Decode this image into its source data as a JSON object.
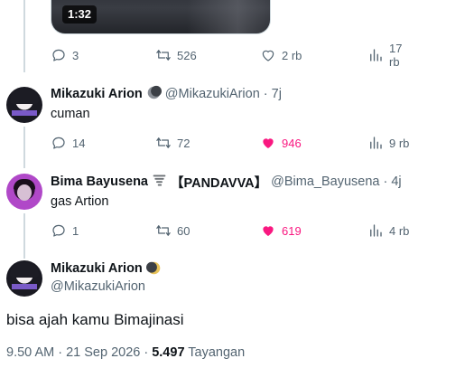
{
  "top_tweet": {
    "video_duration": "1:32",
    "actions": {
      "replies": "3",
      "retweets": "526",
      "likes": "2 rb",
      "views": "17 rb"
    }
  },
  "replies": [
    {
      "name": "Mikazuki Arion",
      "badge_icon": "moon-icon",
      "handle": "@MikazukiArion",
      "time": "· 7j",
      "text": "cuman",
      "actions": {
        "replies": "14",
        "retweets": "72",
        "likes": "946",
        "views": "9 rb",
        "liked": true
      }
    },
    {
      "name": "Bima Bayusena",
      "badge_icon": "tornado-icon",
      "name_suffix": "【PANDAVVA】",
      "handle": "@Bima_Bayusena",
      "time": "· 4j",
      "text": "gas Artion",
      "actions": {
        "replies": "1",
        "retweets": "60",
        "likes": "619",
        "views": "4 rb",
        "liked": true
      }
    }
  ],
  "main_tweet": {
    "name": "Mikazuki Arion",
    "badge_icon": "moon-icon",
    "handle": "@MikazukiArion",
    "text": "bisa ajah kamu Bimajinasi",
    "time": "9.50 AM · 21 Sep 2026 · ",
    "views_count": "5.497",
    "views_label": " Tayangan"
  },
  "colors": {
    "like_active": "#f91880",
    "muted": "#536471",
    "text": "#0f1419"
  }
}
